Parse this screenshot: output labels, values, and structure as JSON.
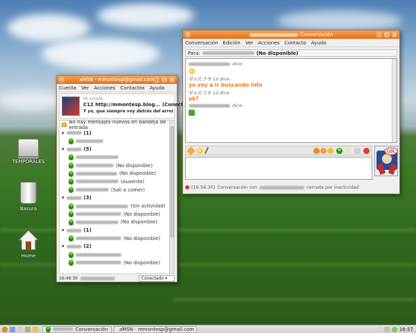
{
  "desktop": {
    "icons": [
      {
        "label": "TEMPORALES",
        "icon": "drive-icon"
      },
      {
        "label": "Basura",
        "icon": "trash-icon"
      },
      {
        "label": "Home",
        "icon": "home-icon"
      }
    ]
  },
  "amsn": {
    "title": "aMSN - mmontesp@gmail.com",
    "menu": [
      "Cuenta",
      "Ver",
      "Acciones",
      "Contactos",
      "Ayuda"
    ],
    "my_status_label": "Mi estado",
    "my_nick": "C12 http://mmontesp.blog... (Conectado)",
    "my_psm": "Y yo, que siempre voy detrás del error, que c",
    "inbox_text": "No hay mensajes nuevos en bandeja de entrada",
    "groups": [
      {
        "count": "(1)",
        "contacts": [
          {
            "status": ""
          }
        ]
      },
      {
        "count": "(5)",
        "contacts": [
          {
            "status": ""
          },
          {
            "status": "(No disponible)"
          },
          {
            "status": "(No disponible)"
          },
          {
            "status": "(Ausente)"
          },
          {
            "status": "(Salí a comer)"
          }
        ]
      },
      {
        "count": "(3)",
        "contacts": [
          {
            "status": "(Sin actividad)"
          },
          {
            "status": "(No disponible)"
          },
          {
            "status": "(No disponible)"
          }
        ]
      },
      {
        "count": "(1)",
        "contacts": [
          {
            "status": "(No disponible)"
          }
        ]
      },
      {
        "count": "(2)",
        "contacts": [
          {
            "status": ""
          },
          {
            "status": "(No disponible)"
          }
        ]
      }
    ],
    "footer_time": "16:46:30",
    "footer_status": "Conectado"
  },
  "chat": {
    "title": "Conversación",
    "menu": [
      "Conversación",
      "Edición",
      "Ver",
      "Acciones",
      "Contacto",
      "Ayuda"
    ],
    "to_label": "Para:",
    "to_value": "(No disponible)",
    "messages": [
      {
        "kind": "header",
        "text": "dice:"
      },
      {
        "kind": "emoticon",
        "text": ""
      },
      {
        "kind": "header",
        "text": "せんたうろ 12 dice:"
      },
      {
        "kind": "body",
        "text": "yo voy a ir buscando info"
      },
      {
        "kind": "header",
        "text": "せんたうろ 12 dice:"
      },
      {
        "kind": "body",
        "text": "ok?"
      },
      {
        "kind": "header",
        "text": "dice:"
      },
      {
        "kind": "emoticon",
        "text": ""
      }
    ],
    "status_time": "[16:56:30]",
    "status_prefix": "Conversación con",
    "status_suffix": "cerrada por inactividad",
    "avatar_text": "LOL"
  },
  "taskbar": {
    "buttons": [
      "Conversación",
      "aMSN - mmontesp@gmail.com"
    ],
    "clock": "16:57"
  }
}
